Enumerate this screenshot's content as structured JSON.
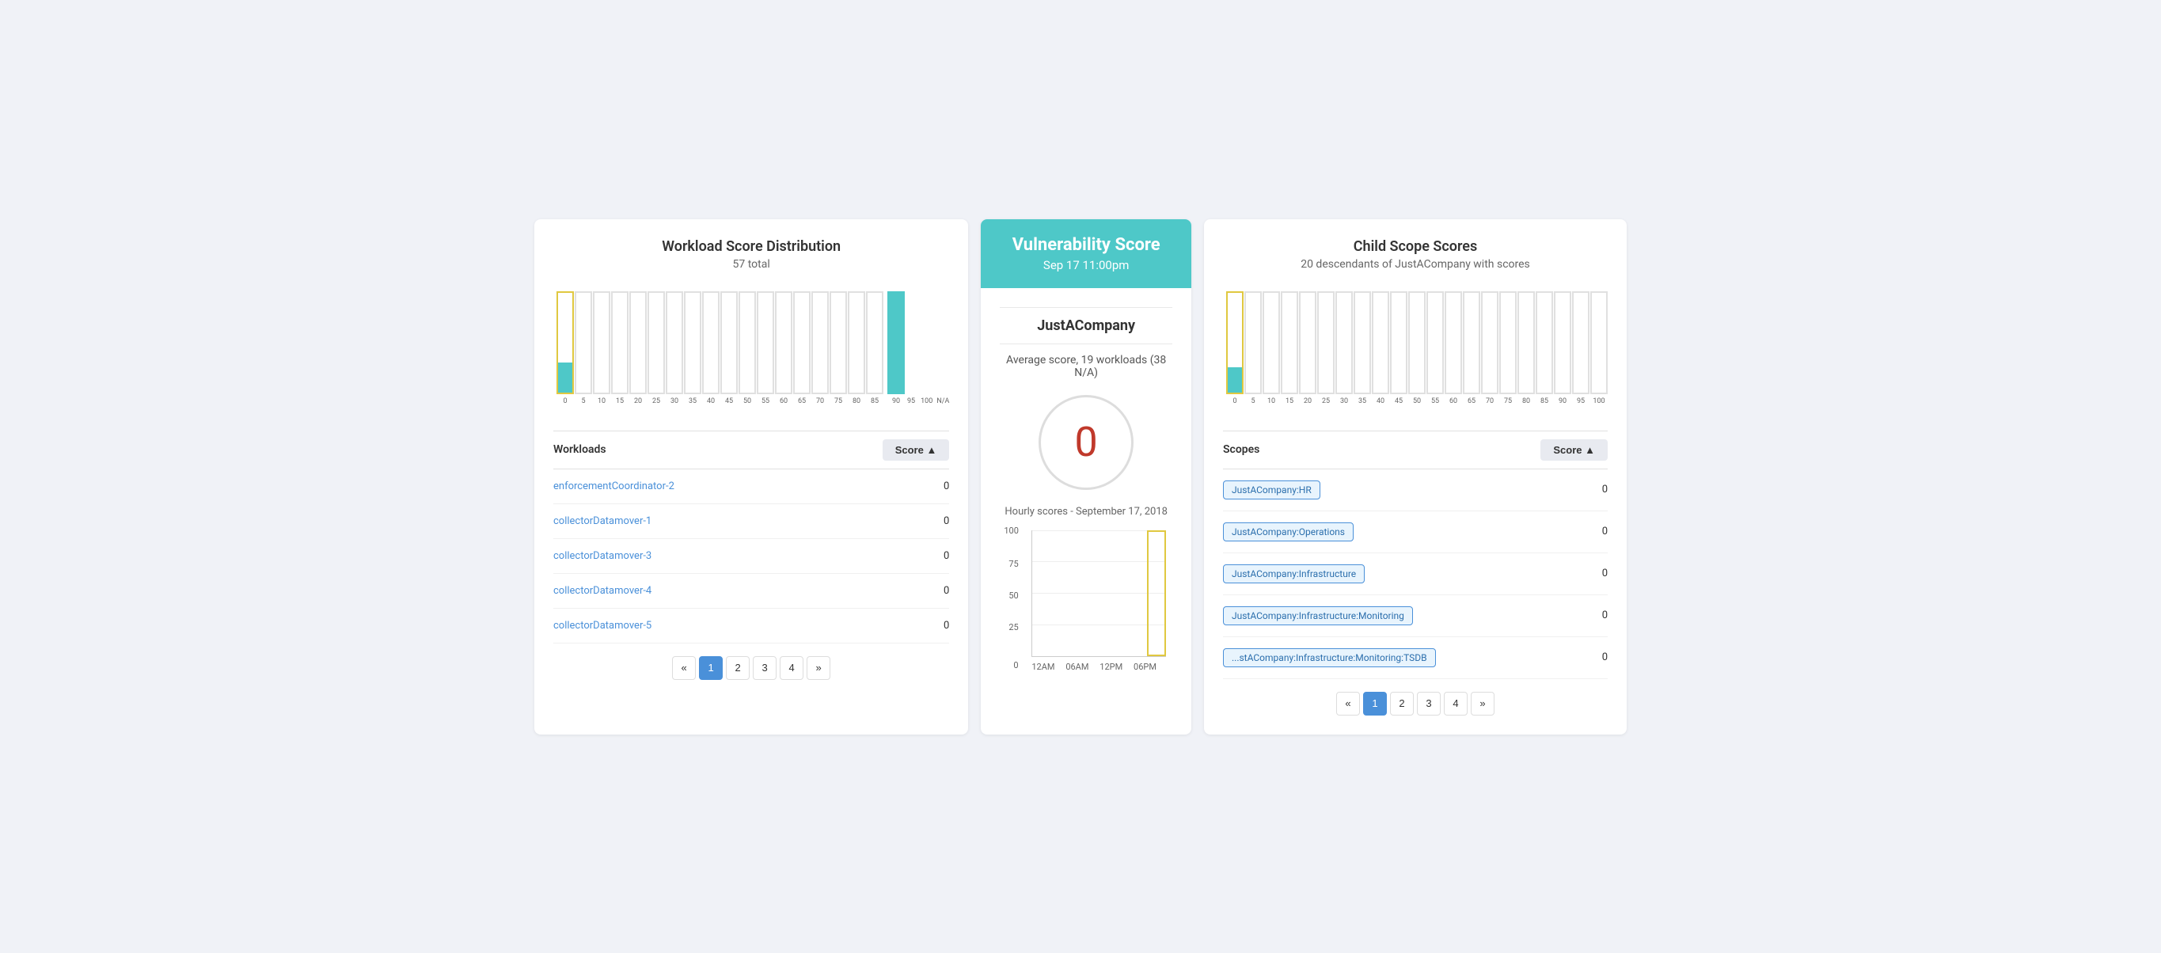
{
  "left_panel": {
    "title": "Workload Score Distribution",
    "subtitle": "57 total",
    "workloads_label": "Workloads",
    "score_label": "Score ▲",
    "rows": [
      {
        "name": "enforcementCoordinator-2",
        "score": "0"
      },
      {
        "name": "collectorDatamover-1",
        "score": "0"
      },
      {
        "name": "collectorDatamover-3",
        "score": "0"
      },
      {
        "name": "collectorDatamover-4",
        "score": "0"
      },
      {
        "name": "collectorDatamover-5",
        "score": "0"
      }
    ],
    "pagination": {
      "prev": "«",
      "pages": [
        "1",
        "2",
        "3",
        "4"
      ],
      "next": "»",
      "active_page": "1"
    },
    "x_labels": [
      "0",
      "5",
      "10",
      "15",
      "20",
      "25",
      "30",
      "35",
      "40",
      "45",
      "50",
      "55",
      "60",
      "65",
      "70",
      "75",
      "80",
      "85",
      "90",
      "95",
      "100",
      "N/A"
    ]
  },
  "middle_panel": {
    "vuln_title": "Vulnerability Score",
    "vuln_date": "Sep 17 11:00pm",
    "company_name": "JustACompany",
    "avg_text": "Average score, 19 workloads (38 N/A)",
    "score_value": "0",
    "hourly_title": "Hourly scores - September 17, 2018",
    "chart_y_labels": [
      "100",
      "75",
      "50",
      "25",
      "0"
    ],
    "chart_x_labels": [
      "12AM",
      "06AM",
      "12PM",
      "06PM"
    ]
  },
  "right_panel": {
    "title": "Child Scope Scores",
    "subtitle": "20 descendants of JustACompany with scores",
    "scopes_label": "Scopes",
    "score_label": "Score ▲",
    "rows": [
      {
        "tag": "JustACompany:HR",
        "score": "0"
      },
      {
        "tag": "JustACompany:Operations",
        "score": "0"
      },
      {
        "tag": "JustACompany:Infrastructure",
        "score": "0"
      },
      {
        "tag": "JustACompany:Infrastructure:Monitoring",
        "score": "0"
      },
      {
        "tag": "...stACompany:Infrastructure:Monitoring:TSDB",
        "score": "0"
      }
    ],
    "pagination": {
      "prev": "«",
      "pages": [
        "1",
        "2",
        "3",
        "4"
      ],
      "next": "»",
      "active_page": "1"
    },
    "x_labels": [
      "0",
      "5",
      "10",
      "15",
      "20",
      "25",
      "30",
      "35",
      "40",
      "45",
      "50",
      "55",
      "60",
      "65",
      "70",
      "75",
      "80",
      "85",
      "90",
      "95",
      "100"
    ]
  },
  "colors": {
    "teal": "#4ec8c8",
    "yellow": "#e0c840",
    "blue_link": "#4a90d9",
    "red": "#c0392b"
  }
}
